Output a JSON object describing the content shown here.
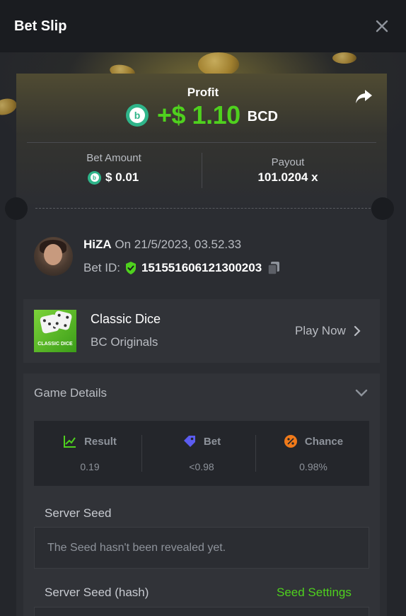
{
  "header": {
    "title": "Bet Slip"
  },
  "summary": {
    "profit_label": "Profit",
    "profit_value": "+$ 1.10",
    "currency": "BCD",
    "bet_amount_label": "Bet Amount",
    "bet_amount_value": "$ 0.01",
    "payout_label": "Payout",
    "payout_value": "101.0204 x"
  },
  "user": {
    "name": "HiZA",
    "date_text": "On 21/5/2023, 03.52.33",
    "bet_id_label": "Bet ID:",
    "bet_id": "151551606121300203"
  },
  "game": {
    "title": "Classic Dice",
    "subtitle": "BC Originals",
    "thumb_label": "CLASSIC DICE",
    "play_label": "Play Now"
  },
  "details": {
    "title": "Game Details",
    "stats": [
      {
        "label": "Result",
        "value": "0.19",
        "icon": "result-icon",
        "color": "#4fd11e"
      },
      {
        "label": "Bet",
        "value": "<0.98",
        "icon": "bet-tag-icon",
        "color": "#5b5cf0"
      },
      {
        "label": "Chance",
        "value": "0.98%",
        "icon": "percent-icon",
        "color": "#f07a1a"
      }
    ],
    "server_seed_label": "Server Seed",
    "server_seed_text": "The Seed hasn't been revealed yet.",
    "server_seed_hash_label": "Server Seed (hash)",
    "seed_settings_label": "Seed Settings"
  },
  "colors": {
    "accent_green": "#4fd11e",
    "coin_green": "#2fb58a",
    "background": "#1a1c20"
  }
}
